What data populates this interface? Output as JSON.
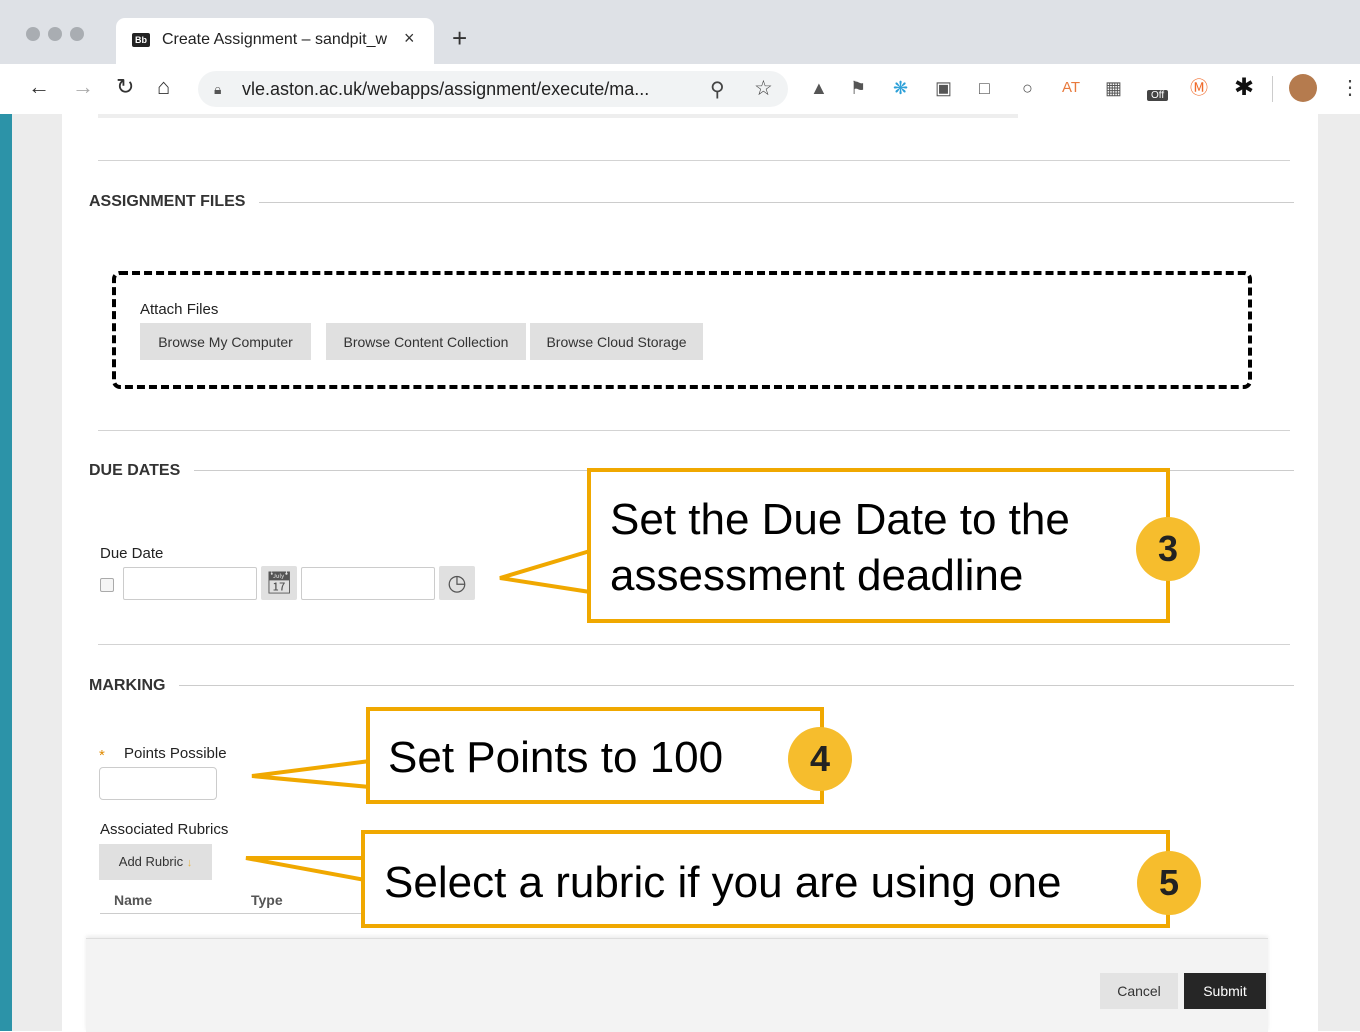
{
  "browser": {
    "tab_title": "Create Assignment – sandpit_w",
    "tab_favicon": "Bb",
    "tab_close": "×",
    "new_tab": "+",
    "url": "vle.aston.ac.uk/webapps/assignment/execute/ma...",
    "extension_at": "AT",
    "extension_off": "Off",
    "icons": [
      "back-icon",
      "forward-icon",
      "reload-icon",
      "home-icon",
      "lock-icon",
      "zoom-icon",
      "star-icon",
      "menu-icon"
    ]
  },
  "sections": {
    "files_title": "ASSIGNMENT FILES",
    "due_title": "DUE DATES",
    "marking_title": "MARKING"
  },
  "files": {
    "attach_label": "Attach Files",
    "browse_computer": "Browse My Computer",
    "browse_content": "Browse Content Collection",
    "browse_cloud": "Browse Cloud Storage"
  },
  "due": {
    "label": "Due Date"
  },
  "marking": {
    "required_star": "*",
    "points_label": "Points Possible",
    "rubrics_label": "Associated Rubrics",
    "add_rubric": "Add Rubric",
    "col_name": "Name",
    "col_type": "Type"
  },
  "footer": {
    "cancel": "Cancel",
    "submit": "Submit"
  },
  "callouts": [
    {
      "text_line1": "Set the Due Date to the",
      "text_line2": "assessment deadline",
      "badge": "3"
    },
    {
      "text": "Set Points to 100",
      "badge": "4"
    },
    {
      "text": "Select a rubric if you are using one",
      "badge": "5"
    }
  ],
  "colors": {
    "callout_border": "#f0a800",
    "badge": "#f6bd2d",
    "submit_bg": "#262626",
    "left_stripe": "#2c93a8"
  }
}
